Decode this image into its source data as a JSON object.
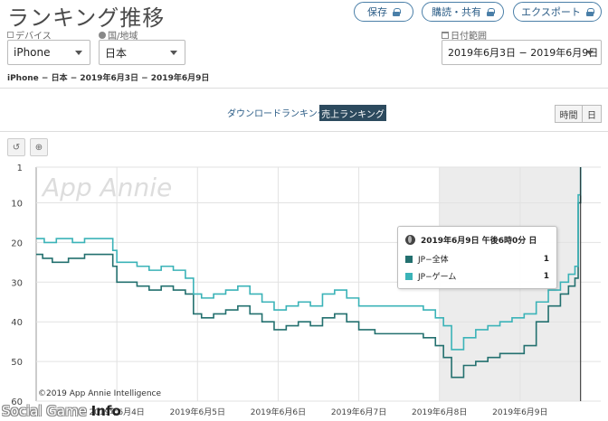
{
  "header": {
    "title": "ランキング推移",
    "buttons": [
      {
        "label": "保存"
      },
      {
        "label": "購読・共有"
      },
      {
        "label": "エクスポート"
      }
    ]
  },
  "filters": {
    "device_label": "デバイス",
    "device_value": "iPhone",
    "region_label": "国/地域",
    "region_value": "日本",
    "date_label": "日付範囲",
    "date_value": "2019年6月3日 − 2019年6月9日"
  },
  "subtitle": "iPhone − 日本 − 2019年6月3日 − 2019年6月9日",
  "tabs": {
    "download": "ダウンロードランキング",
    "sales": "売上ランキング"
  },
  "granularity": {
    "hour": "時間",
    "day": "日"
  },
  "tooltip": {
    "title": "2019年6月9日 午後6時0分 日",
    "rows": [
      {
        "name": "JP−全体",
        "value": "1",
        "color": "#23706f"
      },
      {
        "name": "JP−ゲーム",
        "value": "1",
        "color": "#3bb3b8"
      }
    ]
  },
  "watermark": "App Annie",
  "copyright": "©2019 App Annie Intelligence",
  "site_watermark": {
    "part1": "Social Game ",
    "part2": "Info"
  },
  "chart_data": {
    "type": "line",
    "y_reversed": true,
    "ylim": [
      1,
      60
    ],
    "y_ticks": [
      "1",
      "10",
      "20",
      "30",
      "40",
      "50",
      "60"
    ],
    "x_tick_labels": [
      "2019年6月4日",
      "2019年6月5日",
      "2019年6月6日",
      "2019年6月7日",
      "2019年6月8日",
      "2019年6月9日"
    ],
    "x_tick_days": [
      1,
      2,
      3,
      4,
      5,
      6
    ],
    "x_range_days": [
      0,
      7
    ],
    "highlight_range_days": [
      5.0,
      6.75
    ],
    "cursor_day": 6.75,
    "series": [
      {
        "name": "JP−全体",
        "color": "#23706f",
        "x": [
          0,
          0.08,
          0.2,
          0.4,
          0.6,
          0.75,
          0.85,
          0.95,
          1.0,
          1.1,
          1.25,
          1.4,
          1.55,
          1.7,
          1.85,
          1.95,
          2.05,
          2.2,
          2.35,
          2.5,
          2.65,
          2.8,
          2.95,
          3.1,
          3.25,
          3.4,
          3.55,
          3.7,
          3.85,
          4.0,
          4.2,
          4.4,
          4.6,
          4.8,
          4.95,
          5.05,
          5.15,
          5.3,
          5.45,
          5.6,
          5.75,
          5.9,
          6.05,
          6.2,
          6.35,
          6.5,
          6.6,
          6.68,
          6.72,
          6.75
        ],
        "values": [
          23,
          24,
          25,
          24,
          23,
          23,
          23,
          26,
          30,
          30,
          31,
          32,
          31,
          32,
          33,
          38,
          39,
          38,
          37,
          36,
          38,
          40,
          42,
          41,
          40,
          41,
          39,
          38,
          40,
          42,
          43,
          43,
          43,
          44,
          46,
          49,
          54,
          51,
          50,
          49,
          48,
          48,
          46,
          40,
          36,
          33,
          31,
          29,
          10,
          1
        ]
      },
      {
        "name": "JP−ゲーム",
        "color": "#3bb3b8",
        "x": [
          0,
          0.1,
          0.25,
          0.45,
          0.6,
          0.75,
          0.85,
          0.95,
          1.0,
          1.1,
          1.25,
          1.4,
          1.55,
          1.7,
          1.85,
          1.95,
          2.05,
          2.2,
          2.35,
          2.5,
          2.65,
          2.8,
          2.95,
          3.1,
          3.25,
          3.4,
          3.55,
          3.7,
          3.85,
          4.0,
          4.2,
          4.4,
          4.6,
          4.8,
          4.95,
          5.05,
          5.15,
          5.3,
          5.45,
          5.6,
          5.75,
          5.9,
          6.05,
          6.2,
          6.35,
          6.5,
          6.6,
          6.68,
          6.72,
          6.75
        ],
        "values": [
          19,
          20,
          19,
          20,
          19,
          19,
          19,
          22,
          25,
          25,
          26,
          27,
          26,
          27,
          29,
          33,
          34,
          33,
          32,
          31,
          33,
          35,
          37,
          36,
          35,
          36,
          33,
          32,
          34,
          36,
          36,
          36,
          36,
          37,
          39,
          41,
          47,
          44,
          42,
          41,
          40,
          39,
          38,
          35,
          32,
          30,
          28,
          26,
          8,
          1
        ]
      }
    ]
  }
}
